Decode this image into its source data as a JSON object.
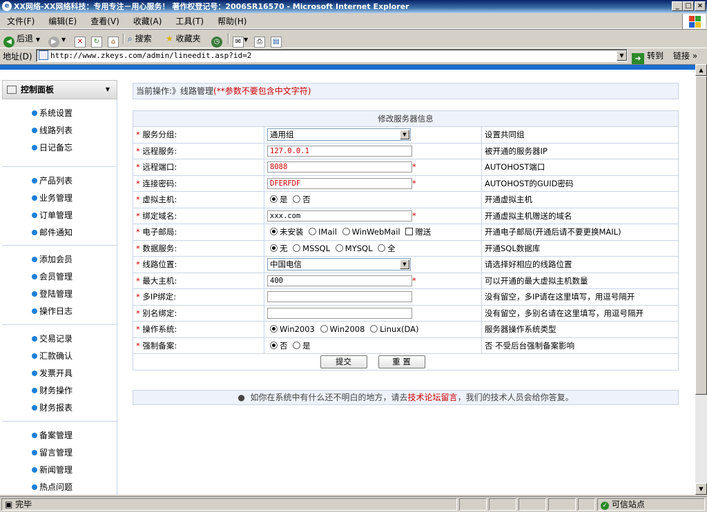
{
  "window": {
    "title": "XX网络-XX网络科技：专用专注－用心服务！ 著作权登记号：2006SR16570 - Microsoft Internet Explorer"
  },
  "menu": [
    "文件(F)",
    "编辑(E)",
    "查看(V)",
    "收藏(A)",
    "工具(T)",
    "帮助(H)"
  ],
  "toolbar": {
    "back": "后退",
    "search": "搜索",
    "favorites": "收藏夹"
  },
  "address": {
    "label": "地址(D)",
    "url": "http://www.zkeys.com/admin/lineedit.asp?id=2",
    "go": "转到",
    "links": "链接"
  },
  "sidebar": {
    "title": "控制面板",
    "groups": [
      [
        "系统设置",
        "线路列表",
        "日记备忘"
      ],
      [
        "产品列表",
        "业务管理",
        "订单管理",
        "邮件通知"
      ],
      [
        "添加会员",
        "会员管理",
        "登陆管理",
        "操作日志"
      ],
      [
        "交易记录",
        "汇款确认",
        "发票开具",
        "财务操作",
        "财务报表"
      ],
      [
        "备案管理",
        "留言管理",
        "新闻管理",
        "热点问题"
      ]
    ]
  },
  "main": {
    "current_op": "当前操作:》线路管理",
    "current_note": "(**参数不要包含中文字符)",
    "form_title": "修改服务器信息",
    "rows": {
      "group": {
        "label": "服务分组:",
        "value": "通用组",
        "desc": "设置共同组"
      },
      "remote": {
        "label": "远程服务:",
        "value": "127.0.0.1",
        "desc": "被开通的服务器IP"
      },
      "port": {
        "label": "远程端口:",
        "value": "8088",
        "desc": "AUTOHOST端口"
      },
      "password": {
        "label": "连接密码:",
        "value": "DFERFDF",
        "desc": "AUTOHOST的GUID密码"
      },
      "vhost": {
        "label": "虚拟主机:",
        "opt_yes": "是",
        "opt_no": "否",
        "desc": "开通虚拟主机"
      },
      "domain": {
        "label": "绑定域名:",
        "value": "xxx.com",
        "desc": "开通虚拟主机赠送的域名"
      },
      "mail": {
        "label": "电子邮局:",
        "opt_none": "未安装",
        "opt_imail": "IMail",
        "opt_webmail": "WinWebMail",
        "opt_gift": "赠送",
        "desc": "开通电子邮局(开通后请不要更换MAIL)"
      },
      "db": {
        "label": "数据服务:",
        "opt_none": "无",
        "opt_mssql": "MSSQL",
        "opt_mysql": "MYSQL",
        "opt_all": "全",
        "desc": "开通SQL数据库"
      },
      "line": {
        "label": "线路位置:",
        "value": "中国电信",
        "desc": "请选择好相应的线路位置"
      },
      "maxhost": {
        "label": "最大主机:",
        "value": "400",
        "desc": "可以开通的最大虚拟主机数量"
      },
      "multiip": {
        "label": "多IP绑定:",
        "value": "",
        "desc": "没有留空，多IP请在这里填写，用逗号隔开"
      },
      "alias": {
        "label": "别名绑定:",
        "value": "",
        "desc": "没有留空，多别名请在这里填写，用逗号隔开"
      },
      "os": {
        "label": "操作系统:",
        "opt_2003": "Win2003",
        "opt_2008": "Win2008",
        "opt_linux": "Linux(DA)",
        "desc": "服务器操作系统类型"
      },
      "icp": {
        "label": "强制备案:",
        "opt_no": "否",
        "opt_yes": "是",
        "desc": "否 不受后台强制备案影响"
      }
    },
    "submit": "提交",
    "reset": "重 置",
    "note_pre": "如你在系统中有什么还不明白的地方，请去",
    "note_link": "技术论坛留言",
    "note_post": "，我们的技术人员会给你答复。"
  },
  "status": {
    "left": "完毕",
    "zone": "可信站点"
  }
}
